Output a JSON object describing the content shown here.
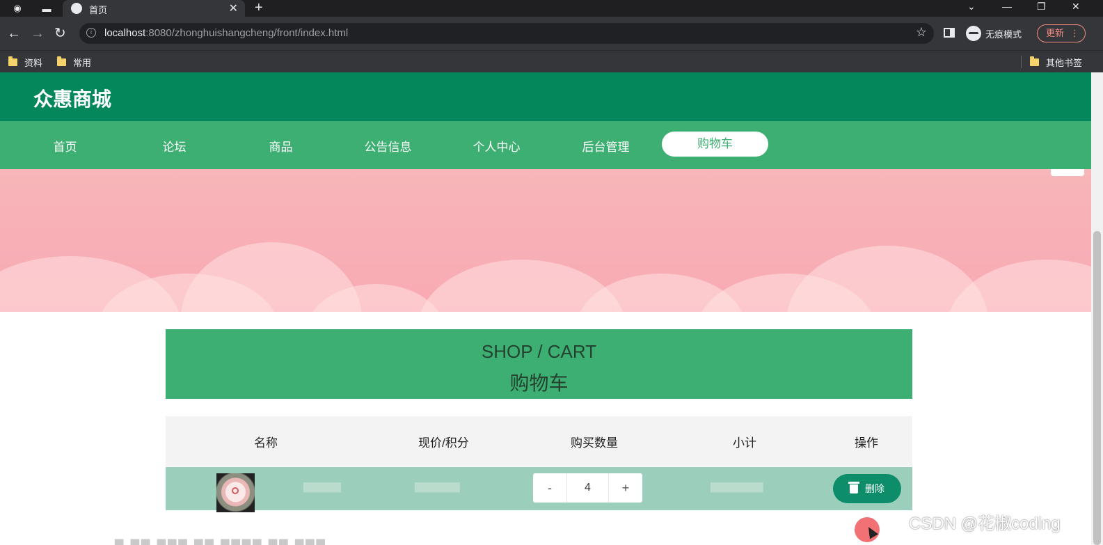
{
  "browser": {
    "tab_title": "首页",
    "url_host": "localhost",
    "url_rest": ":8080/zhonghuishangcheng/front/index.html",
    "incognito_label": "无痕模式",
    "update_label": "更新",
    "bookmarks": [
      "资料",
      "常用"
    ],
    "other_bookmarks": "其他书签"
  },
  "site": {
    "name": "众惠商城",
    "nav": [
      "首页",
      "论坛",
      "商品",
      "公告信息",
      "个人中心",
      "后台管理",
      "购物车"
    ],
    "active_nav": "购物车"
  },
  "banner": {
    "slides": 3,
    "active_slide": 1
  },
  "cart": {
    "title_en": "SHOP / CART",
    "title_cn": "购物车",
    "columns": [
      "名称",
      "现价/积分",
      "购买数量",
      "小计",
      "操作"
    ],
    "items": [
      {
        "quantity": "4",
        "delete_label": "删除",
        "minus": "-",
        "plus": "+"
      }
    ]
  },
  "watermark": "CSDN @花椒coding",
  "colors": {
    "brand_dark": "#04875a",
    "nav_green": "#3daf72",
    "row_green": "#9ccfbb",
    "banner_pink": "#f7b6b9",
    "delete_button": "#0d8d6a"
  }
}
